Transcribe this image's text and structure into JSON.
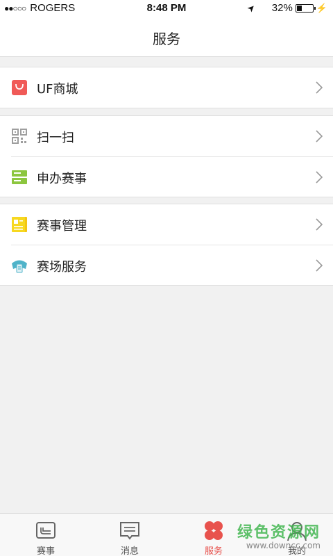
{
  "status_bar": {
    "signal": "●●○○○",
    "carrier": "ROGERS",
    "time": "8:48 PM",
    "battery_percent": "32%",
    "battery_level": 0.32
  },
  "header": {
    "title": "服务"
  },
  "menu": {
    "groups": [
      {
        "items": [
          {
            "label": "UF商城",
            "icon": "shopping-bag-icon",
            "color": "#f05a57"
          }
        ]
      },
      {
        "items": [
          {
            "label": "扫一扫",
            "icon": "qr-code-icon",
            "color": "#9e9e9e"
          },
          {
            "label": "申办赛事",
            "icon": "server-icon",
            "color": "#8cc63f"
          }
        ]
      },
      {
        "items": [
          {
            "label": "赛事管理",
            "icon": "clipboard-icon",
            "color": "#f7d820"
          },
          {
            "label": "赛场服务",
            "icon": "stadium-service-icon",
            "color": "#4fb3c9"
          }
        ]
      }
    ]
  },
  "tab_bar": {
    "tabs": [
      {
        "label": "赛事",
        "icon": "match-icon"
      },
      {
        "label": "消息",
        "icon": "message-icon"
      },
      {
        "label": "服务",
        "icon": "clover-icon",
        "active": true
      },
      {
        "label": "我的",
        "icon": "profile-icon"
      }
    ],
    "active_color": "#e8524d"
  },
  "watermark": {
    "main": "绿色资源网",
    "sub": "www.downcc.com"
  }
}
